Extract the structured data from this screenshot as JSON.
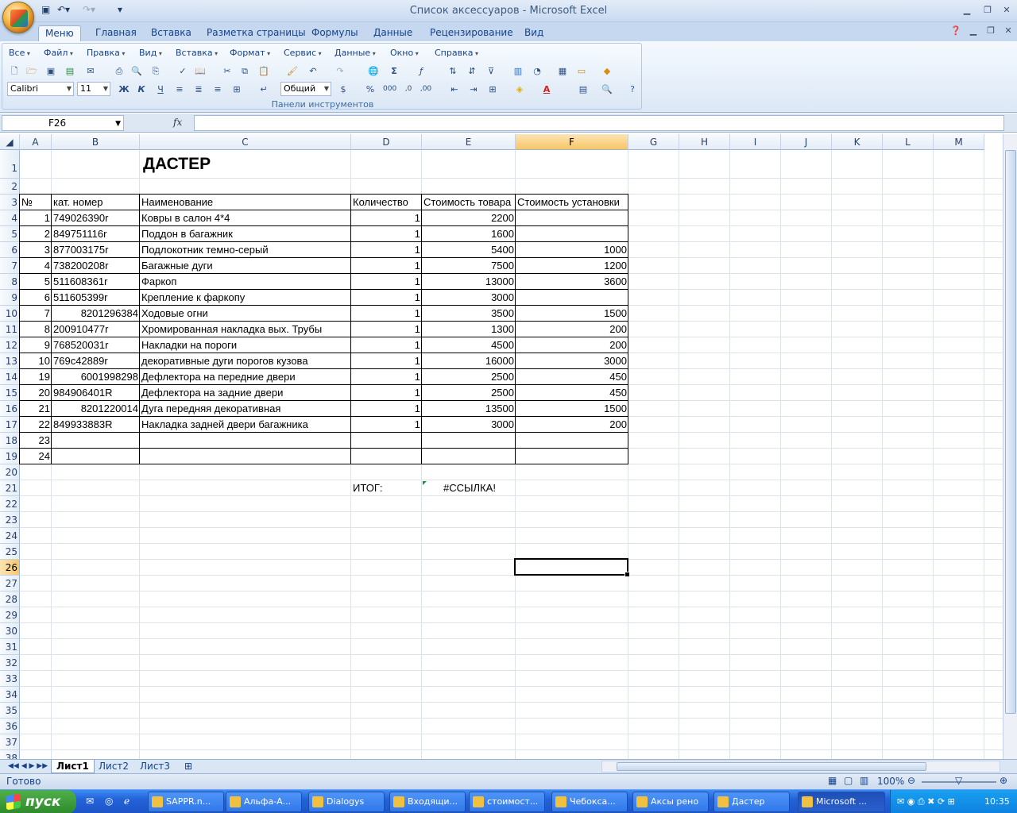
{
  "window": {
    "title": "Список аксессуаров - Microsoft Excel"
  },
  "ribbon_tabs": [
    "Меню",
    "Главная",
    "Вставка",
    "Разметка страницы",
    "Формулы",
    "Данные",
    "Рецензирование",
    "Вид"
  ],
  "active_tab": "Меню",
  "menus": [
    "Все",
    "Файл",
    "Правка",
    "Вид",
    "Вставка",
    "Формат",
    "Сервис",
    "Данные",
    "Окно",
    "Справка"
  ],
  "toolbar": {
    "font_name": "Calibri",
    "font_size": "11",
    "number_format": "Общий",
    "group_label": "Панели инструментов",
    "bold_label": "Ж",
    "italic_label": "К",
    "underline_label": "Ч"
  },
  "formula_bar": {
    "name_box": "F26",
    "fx_label": "fx",
    "content": ""
  },
  "columns": [
    "A",
    "B",
    "C",
    "D",
    "E",
    "F",
    "G",
    "H",
    "I",
    "J",
    "K",
    "L",
    "M"
  ],
  "selected_column": "F",
  "selected_row": 26,
  "rows": [
    1,
    2,
    3,
    4,
    5,
    6,
    7,
    8,
    9,
    10,
    11,
    12,
    13,
    14,
    15,
    16,
    17,
    18,
    19,
    20,
    21,
    22,
    23,
    24,
    25,
    26,
    27,
    28,
    29,
    30,
    31,
    32,
    33,
    34,
    35,
    36,
    37,
    38
  ],
  "sheet": {
    "title": "ДАСТЕР",
    "headers": {
      "num": "№",
      "cat": "кат. номер",
      "name": "Наименование",
      "qty": "Количество",
      "price": "Стоимость товара",
      "install": "Стоимость установки"
    },
    "items": [
      {
        "num": "1",
        "cat": "749026390r",
        "cat_align": "left",
        "name": "Ковры в салон 4*4",
        "qty": "1",
        "price": "2200",
        "install": ""
      },
      {
        "num": "2",
        "cat": "849751116r",
        "cat_align": "left",
        "name": "Поддон в багажник",
        "qty": "1",
        "price": "1600",
        "install": ""
      },
      {
        "num": "3",
        "cat": "877003175r",
        "cat_align": "left",
        "name": "Подлокотник темно-серый",
        "qty": "1",
        "price": "5400",
        "install": "1000"
      },
      {
        "num": "4",
        "cat": "738200208r",
        "cat_align": "left",
        "name": "Багажные дуги",
        "qty": "1",
        "price": "7500",
        "install": "1200"
      },
      {
        "num": "5",
        "cat": "511608361r",
        "cat_align": "left",
        "name": "Фаркоп",
        "qty": "1",
        "price": "13000",
        "install": "3600"
      },
      {
        "num": "6",
        "cat": "511605399r",
        "cat_align": "left",
        "name": "Крепление  к фаркопу",
        "qty": "1",
        "price": "3000",
        "install": ""
      },
      {
        "num": "7",
        "cat": "8201296384",
        "cat_align": "right",
        "name": "Ходовые огни",
        "qty": "1",
        "price": "3500",
        "install": "1500"
      },
      {
        "num": "8",
        "cat": "200910477r",
        "cat_align": "left",
        "name": "Хромированная накладка вых. Трубы",
        "qty": "1",
        "price": "1300",
        "install": "200"
      },
      {
        "num": "9",
        "cat": "768520031r",
        "cat_align": "left",
        "name": "Накладки на пороги",
        "qty": "1",
        "price": "4500",
        "install": "200"
      },
      {
        "num": "10",
        "cat": "769c42889r",
        "cat_align": "left",
        "name": "декоративные дуги порогов кузова",
        "qty": "1",
        "price": "16000",
        "install": "3000"
      },
      {
        "num": "19",
        "cat": "6001998298",
        "cat_align": "right",
        "name": "Дефлектора на передние двери",
        "qty": "1",
        "price": "2500",
        "install": "450"
      },
      {
        "num": "20",
        "cat": "984906401R",
        "cat_align": "left",
        "name": "Дефлектора на задние двери",
        "qty": "1",
        "price": "2500",
        "install": "450"
      },
      {
        "num": "21",
        "cat": "8201220014",
        "cat_align": "right",
        "name": "Дуга передняя декоративная",
        "qty": "1",
        "price": "13500",
        "install": "1500"
      },
      {
        "num": "22",
        "cat": "849933883R",
        "cat_align": "left",
        "name": "Накладка задней двери багажника",
        "qty": "1",
        "price": "3000",
        "install": "200"
      },
      {
        "num": "23",
        "cat": "",
        "cat_align": "left",
        "name": "",
        "qty": "",
        "price": "",
        "install": ""
      },
      {
        "num": "24",
        "cat": "",
        "cat_align": "left",
        "name": "",
        "qty": "",
        "price": "",
        "install": ""
      }
    ],
    "total_label": "ИТОГ:",
    "total_value": "#ССЫЛКА!"
  },
  "sheet_tabs": [
    "Лист1",
    "Лист2",
    "Лист3"
  ],
  "active_sheet": "Лист1",
  "status": {
    "ready": "Готово",
    "zoom": "100%"
  },
  "taskbar": {
    "start_label": "пуск",
    "tasks": [
      "SAPPR.n...",
      "Альфа-А...",
      "Dialogys",
      "Входящи...",
      "стоимост...",
      "Чебокса...",
      "Аксы рено",
      "Дастер",
      "Microsoft ..."
    ],
    "active_task": "Microsoft ...",
    "clock": "10:35"
  }
}
